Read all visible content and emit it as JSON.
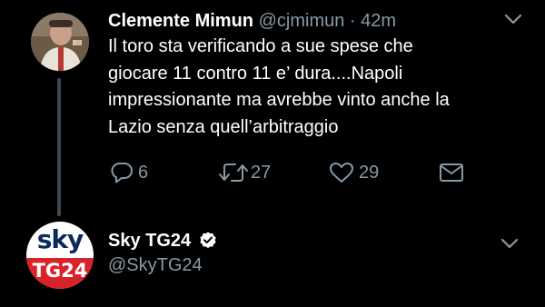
{
  "colors": {
    "background": "#000000",
    "primary_text": "#ffffff",
    "secondary_text": "#8899a6",
    "thread_line": "#3d4a56",
    "sky_blue": "#0a2a5c",
    "sky_red": "#d8232a"
  },
  "tweet1": {
    "display_name": "Clemente Mimun",
    "handle": "@cjmimun",
    "separator": "·",
    "time": "42m",
    "text": "Il toro sta verificando a sue spese che\ngiocare  11 contro 11 e’ dura....Napoli\nimpressionante ma avrebbe vinto anche la\nLazio senza quell’arbitraggio",
    "actions": {
      "reply_count": "6",
      "retweet_count": "27",
      "like_count": "29"
    },
    "icons": [
      "chevron-down-icon",
      "reply-icon",
      "retweet-icon",
      "heart-icon",
      "envelope-icon"
    ]
  },
  "tweet2": {
    "display_name": "Sky TG24",
    "handle": "@SkyTG24",
    "avatar_logo_top": "sky",
    "avatar_logo_bottom": "TG24",
    "icons": [
      "verified-badge-icon",
      "chevron-down-icon"
    ]
  }
}
